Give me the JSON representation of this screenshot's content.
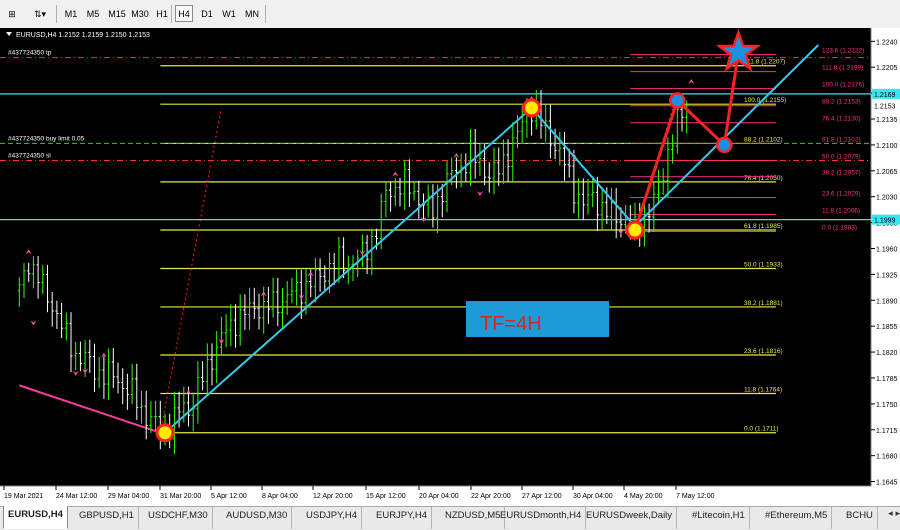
{
  "toolbar": {
    "timeframes": [
      "M1",
      "M5",
      "M15",
      "M30",
      "H1",
      "H4",
      "D1",
      "W1",
      "MN"
    ],
    "active_timeframe": "H4"
  },
  "chart_header": {
    "symbol": "EURUSD,H4",
    "ohlc": "1.2152 1.2159 1.2150 1.2153"
  },
  "order_labels": {
    "tp": "#437724350 tp",
    "buy_limit": "#437724350 buy limit 0.05",
    "sl": "#437724350 sl"
  },
  "tf_box": {
    "text": "TF=4H",
    "bg": "#1e9ad8",
    "fg": "#d7261e"
  },
  "tabs": [
    "EURUSD,H4",
    "GBPUSD,H1",
    "USDCHF,M30",
    "AUDUSD,M30",
    "USDJPY,H4",
    "EURJPY,H4",
    "NZDUSD,M5",
    "EURUSDmonth,H4",
    "EURUSDweek,Daily",
    "#Litecoin,H1",
    "#Ethereum,M5",
    "BCHU"
  ],
  "active_tab": "EURUSD,H4",
  "colors": {
    "background": "#000000",
    "bull": "#33ff00",
    "trend": "#36c8e8",
    "fib_big": "#e6e64a",
    "fib_small": "#ff2f86",
    "price_line": "#36e6f0",
    "marker_fill": "#ffeb00",
    "marker_ring": "#ff1e1e",
    "projection": "#ff2020"
  },
  "chart_data": {
    "type": "line",
    "symbol": "EURUSD",
    "timeframe": "H4",
    "ylim": [
      1.1639,
      1.2258
    ],
    "y_ticks": [
      1.1645,
      1.168,
      1.1715,
      1.175,
      1.1785,
      1.182,
      1.1855,
      1.189,
      1.1925,
      1.196,
      1.1995,
      1.203,
      1.2065,
      1.21,
      1.2135,
      1.217,
      1.2205,
      1.224
    ],
    "price_tag_labels": [
      {
        "value": 1.2169,
        "label": "1.2169",
        "color": "#36e6f0"
      },
      {
        "value": 1.2153,
        "label": "1.2153",
        "color": "#ffffff"
      },
      {
        "value": 1.1999,
        "label": "1.1999",
        "color": "#36e6f0"
      }
    ],
    "x_labels": [
      "19 Mar 2021",
      "24 Mar 12:00",
      "29 Mar 04:00",
      "31 Mar 20:00",
      "5 Apr 12:00",
      "8 Apr 04:00",
      "12 Apr 20:00",
      "15 Apr 12:00",
      "20 Apr 04:00",
      "22 Apr 20:00",
      "27 Apr 12:00",
      "30 Apr 04:00",
      "4 May 20:00",
      "7 May 12:00"
    ],
    "close_path": [
      [
        0,
        1.1903
      ],
      [
        2,
        1.1942
      ],
      [
        4,
        1.1922
      ],
      [
        6,
        1.1893
      ],
      [
        8,
        1.1872
      ],
      [
        10,
        1.184
      ],
      [
        12,
        1.1816
      ],
      [
        14,
        1.1812
      ],
      [
        16,
        1.1795
      ],
      [
        18,
        1.179
      ],
      [
        20,
        1.1788
      ],
      [
        22,
        1.1775
      ],
      [
        24,
        1.1765
      ],
      [
        26,
        1.1742
      ],
      [
        28,
        1.1728
      ],
      [
        30,
        1.1716
      ],
      [
        31,
        1.1711
      ],
      [
        33,
        1.173
      ],
      [
        35,
        1.1748
      ],
      [
        36,
        1.174
      ],
      [
        38,
        1.177
      ],
      [
        40,
        1.18
      ],
      [
        42,
        1.1826
      ],
      [
        44,
        1.185
      ],
      [
        46,
        1.1862
      ],
      [
        48,
        1.1872
      ],
      [
        50,
        1.1882
      ],
      [
        52,
        1.1878
      ],
      [
        54,
        1.1886
      ],
      [
        56,
        1.189
      ],
      [
        58,
        1.19
      ],
      [
        60,
        1.1905
      ],
      [
        62,
        1.1914
      ],
      [
        64,
        1.1922
      ],
      [
        66,
        1.1935
      ],
      [
        68,
        1.1943
      ],
      [
        70,
        1.194
      ],
      [
        72,
        1.1945
      ],
      [
        74,
        1.196
      ],
      [
        76,
        1.1985
      ],
      [
        78,
        1.2035
      ],
      [
        80,
        1.2042
      ],
      [
        82,
        1.2047
      ],
      [
        84,
        1.2036
      ],
      [
        86,
        1.202
      ],
      [
        88,
        1.201
      ],
      [
        90,
        1.204
      ],
      [
        92,
        1.206
      ],
      [
        94,
        1.207
      ],
      [
        96,
        1.2085
      ],
      [
        98,
        1.2075
      ],
      [
        100,
        1.206
      ],
      [
        102,
        1.2065
      ],
      [
        104,
        1.209
      ],
      [
        106,
        1.2115
      ],
      [
        108,
        1.214
      ],
      [
        109,
        1.215
      ],
      [
        110,
        1.214
      ],
      [
        112,
        1.212
      ],
      [
        114,
        1.21
      ],
      [
        116,
        1.2075
      ],
      [
        118,
        1.204
      ],
      [
        120,
        1.202
      ],
      [
        122,
        1.203
      ],
      [
        124,
        1.2015
      ],
      [
        126,
        1.2005
      ],
      [
        128,
        1.2
      ],
      [
        130,
        1.1995
      ],
      [
        131,
        1.1985
      ],
      [
        132,
        1.1992
      ],
      [
        134,
        1.201
      ],
      [
        136,
        1.204
      ],
      [
        138,
        1.209
      ],
      [
        140,
        1.213
      ],
      [
        142,
        1.215
      ],
      [
        143,
        1.2153
      ]
    ],
    "up_arrows": [
      [
        3,
        1.186
      ],
      [
        12,
        1.1792
      ],
      [
        14,
        1.1795
      ],
      [
        31,
        1.1708
      ],
      [
        43,
        1.1835
      ],
      [
        60,
        1.1895
      ],
      [
        73,
        1.1955
      ],
      [
        86,
        1.2
      ],
      [
        98,
        1.2035
      ],
      [
        128,
        1.1983
      ],
      [
        131,
        1.198
      ]
    ],
    "down_arrows": [
      [
        2,
        1.1955
      ],
      [
        18,
        1.1815
      ],
      [
        36,
        1.1765
      ],
      [
        52,
        1.1898
      ],
      [
        62,
        1.1925
      ],
      [
        80,
        1.206
      ],
      [
        93,
        1.2085
      ],
      [
        109,
        1.2162
      ],
      [
        118,
        1.2085
      ],
      [
        143,
        1.2185
      ]
    ],
    "swing_points": [
      {
        "x": 31,
        "y": 1.1711
      },
      {
        "x": 109,
        "y": 1.215
      },
      {
        "x": 131,
        "y": 1.1985
      }
    ],
    "projection_points": [
      {
        "x": 131,
        "y": 1.1985
      },
      {
        "x": 140,
        "y": 1.216
      },
      {
        "x": 150,
        "y": 1.21
      }
    ],
    "projection_target": {
      "x": 153,
      "y": 1.2225
    },
    "trendline_main": [
      [
        31,
        1.1711
      ],
      [
        109,
        1.215
      ]
    ],
    "trendline_second": [
      [
        131,
        1.199
      ],
      [
        170,
        1.2235
      ]
    ],
    "left_down_line": [
      [
        0,
        1.1775
      ],
      [
        30,
        1.1711
      ]
    ],
    "fib_major": {
      "x_from": 30,
      "x_to": 161,
      "levels": [
        {
          "label": "0.0",
          "price": 1.1711
        },
        {
          "label": "11.8",
          "price": 1.1764
        },
        {
          "label": "23.6",
          "price": 1.1816
        },
        {
          "label": "38.2",
          "price": 1.1881
        },
        {
          "label": "50.0",
          "price": 1.1933
        },
        {
          "label": "61.8",
          "price": 1.1985
        },
        {
          "label": "76.4",
          "price": 1.205
        },
        {
          "label": "88.2",
          "price": 1.2102
        },
        {
          "label": "100.0",
          "price": 1.2155
        },
        {
          "label": "111.8",
          "price": 1.2207
        }
      ]
    },
    "fib_minor": {
      "x_from": 130,
      "x_to": 161,
      "levels": [
        {
          "label": "0.0",
          "price": 1.1983
        },
        {
          "label": "11.8",
          "price": 1.2006
        },
        {
          "label": "23.6",
          "price": 1.2029
        },
        {
          "label": "38.2",
          "price": 1.2057
        },
        {
          "label": "50.0",
          "price": 1.2079
        },
        {
          "label": "61.8",
          "price": 1.2102
        },
        {
          "label": "76.4",
          "price": 1.213
        },
        {
          "label": "88.2",
          "price": 1.2153
        },
        {
          "label": "100.0",
          "price": 1.2176
        },
        {
          "label": "111.8",
          "price": 1.2199
        },
        {
          "label": "123.6",
          "price": 1.2222
        }
      ]
    },
    "tp_price": 1.2218,
    "buy_limit_price": 1.2102,
    "sl_price": 1.2079,
    "price_line_high": 1.2169,
    "price_line_current": 1.1999
  }
}
